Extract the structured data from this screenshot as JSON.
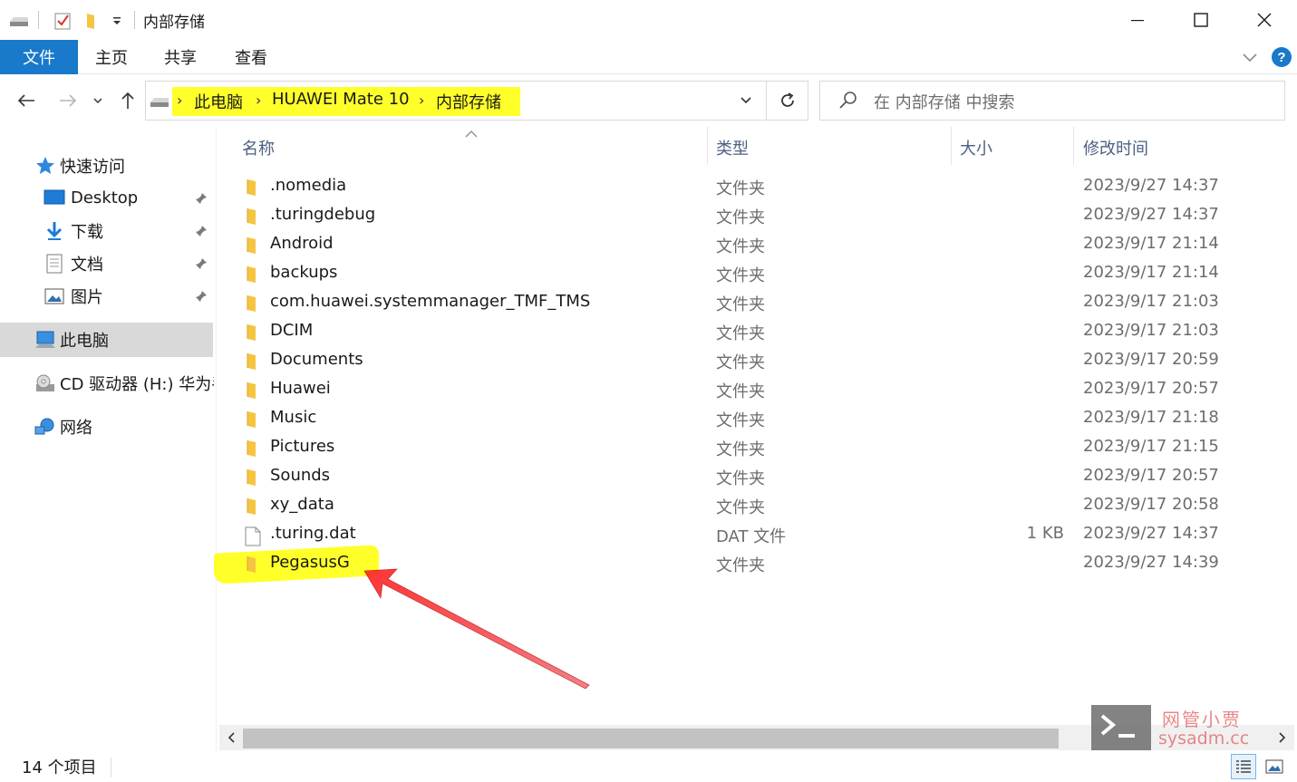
{
  "window": {
    "title": "内部存储",
    "minimize_icon": "minimize-icon",
    "maximize_icon": "maximize-icon",
    "close_icon": "close-icon"
  },
  "ribbon": {
    "tabs": [
      "文件",
      "主页",
      "共享",
      "查看"
    ],
    "help_icon": "?"
  },
  "address": {
    "crumbs": [
      "此电脑",
      "HUAWEI Mate 10",
      "内部存储"
    ],
    "highlight_color": "#ffff2a"
  },
  "search": {
    "placeholder": "在 内部存储 中搜索"
  },
  "nav": {
    "quick_access": "快速访问",
    "items": [
      "Desktop",
      "下载",
      "文档",
      "图片"
    ],
    "this_pc": "此电脑",
    "cd_drive": "CD 驱动器 (H:) 华为手机助手",
    "network": "网络"
  },
  "columns": {
    "name": "名称",
    "type": "类型",
    "size": "大小",
    "modified": "修改时间"
  },
  "files": [
    {
      "name": ".nomedia",
      "type": "文件夹",
      "size": "",
      "date": "2023/9/27 14:37",
      "kind": "folder"
    },
    {
      "name": ".turingdebug",
      "type": "文件夹",
      "size": "",
      "date": "2023/9/27 14:37",
      "kind": "folder"
    },
    {
      "name": "Android",
      "type": "文件夹",
      "size": "",
      "date": "2023/9/17 21:14",
      "kind": "folder"
    },
    {
      "name": "backups",
      "type": "文件夹",
      "size": "",
      "date": "2023/9/17 21:14",
      "kind": "folder"
    },
    {
      "name": "com.huawei.systemmanager_TMF_TMS",
      "type": "文件夹",
      "size": "",
      "date": "2023/9/17 21:03",
      "kind": "folder"
    },
    {
      "name": "DCIM",
      "type": "文件夹",
      "size": "",
      "date": "2023/9/17 21:03",
      "kind": "folder"
    },
    {
      "name": "Documents",
      "type": "文件夹",
      "size": "",
      "date": "2023/9/17 20:59",
      "kind": "folder"
    },
    {
      "name": "Huawei",
      "type": "文件夹",
      "size": "",
      "date": "2023/9/17 20:57",
      "kind": "folder"
    },
    {
      "name": "Music",
      "type": "文件夹",
      "size": "",
      "date": "2023/9/17 21:18",
      "kind": "folder"
    },
    {
      "name": "Pictures",
      "type": "文件夹",
      "size": "",
      "date": "2023/9/17 21:15",
      "kind": "folder"
    },
    {
      "name": "Sounds",
      "type": "文件夹",
      "size": "",
      "date": "2023/9/17 20:57",
      "kind": "folder"
    },
    {
      "name": "xy_data",
      "type": "文件夹",
      "size": "",
      "date": "2023/9/17 20:58",
      "kind": "folder"
    },
    {
      "name": ".turing.dat",
      "type": "DAT 文件",
      "size": "1 KB",
      "date": "2023/9/27 14:37",
      "kind": "file"
    },
    {
      "name": "PegasusG",
      "type": "文件夹",
      "size": "",
      "date": "2023/9/27 14:39",
      "kind": "folder"
    }
  ],
  "status": {
    "count": "14 个项目"
  },
  "watermark": {
    "line1": "网管小贾",
    "line2": "sysadm.cc"
  },
  "colors": {
    "accent": "#1979ca",
    "highlight": "#ffff2a",
    "arrow": "#e8202a",
    "folder": "#f5c542"
  }
}
